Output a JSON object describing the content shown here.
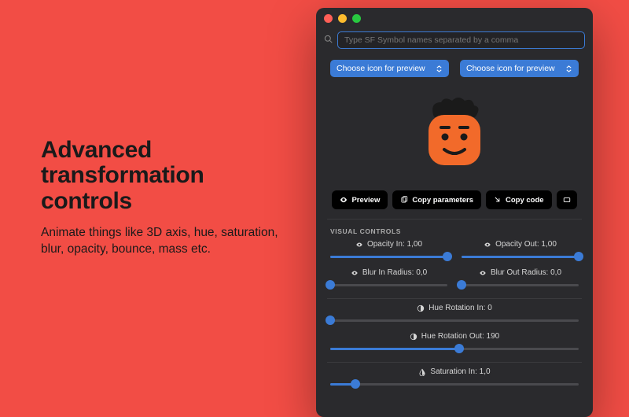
{
  "marketing": {
    "headline": "Advanced transformation controls",
    "subline": "Animate things like 3D axis, hue, saturation, blur, opacity, bounce, mass etc."
  },
  "search": {
    "placeholder": "Type SF Symbol names separated by a comma"
  },
  "dropdowns": {
    "left": "Choose icon for preview",
    "right": "Choose icon for preview"
  },
  "actions": {
    "preview": "Preview",
    "copy_parameters": "Copy parameters",
    "copy_code": "Copy code"
  },
  "section": {
    "visual_controls": "VISUAL CONTROLS"
  },
  "sliders": {
    "opacity_in": {
      "label": "Opacity In: 1,00",
      "pct": 100
    },
    "opacity_out": {
      "label": "Opacity Out: 1,00",
      "pct": 100
    },
    "blur_in": {
      "label": "Blur In Radius: 0,0",
      "pct": 0
    },
    "blur_out": {
      "label": "Blur Out Radius: 0,0",
      "pct": 0
    },
    "hue_in": {
      "label": "Hue Rotation In: 0",
      "pct": 0
    },
    "hue_out": {
      "label": "Hue Rotation Out: 190",
      "pct": 52
    },
    "sat_in": {
      "label": "Saturation In: 1,0",
      "pct": 10
    }
  },
  "colors": {
    "accent": "#3b7bd6",
    "bg": "#f24d45",
    "panel": "#2a2a2d"
  }
}
